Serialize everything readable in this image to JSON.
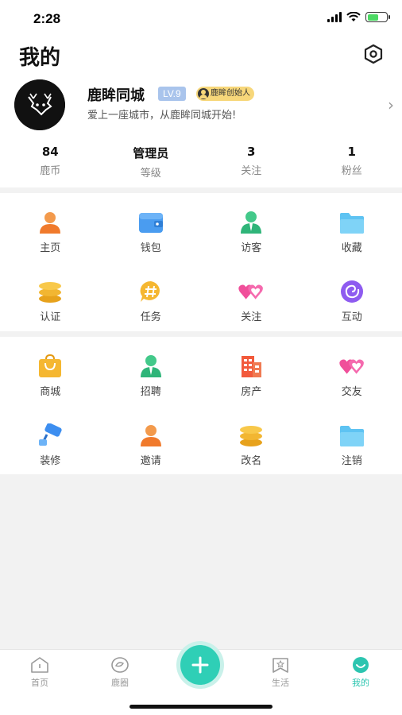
{
  "status": {
    "time": "2:28"
  },
  "header": {
    "title": "我的"
  },
  "profile": {
    "name": "鹿眸同城",
    "level": "LV.9",
    "badge": "鹿眸创始人",
    "bio": "爱上一座城市，从鹿眸同城开始!"
  },
  "stats": [
    {
      "value": "84",
      "label": "鹿币"
    },
    {
      "value": "管理员",
      "label": "等级"
    },
    {
      "value": "3",
      "label": "关注"
    },
    {
      "value": "1",
      "label": "粉丝"
    }
  ],
  "grid1": [
    {
      "label": "主页",
      "icon": "person-icon"
    },
    {
      "label": "钱包",
      "icon": "wallet-icon"
    },
    {
      "label": "访客",
      "icon": "visitor-icon"
    },
    {
      "label": "收藏",
      "icon": "folder-icon"
    },
    {
      "label": "认证",
      "icon": "coins-icon"
    },
    {
      "label": "任务",
      "icon": "hashtag-icon"
    },
    {
      "label": "关注",
      "icon": "hearts-icon"
    },
    {
      "label": "互动",
      "icon": "swirl-icon"
    }
  ],
  "grid2": [
    {
      "label": "商城",
      "icon": "shopping-bag-icon"
    },
    {
      "label": "招聘",
      "icon": "recruit-icon"
    },
    {
      "label": "房产",
      "icon": "building-icon"
    },
    {
      "label": "交友",
      "icon": "hearts-icon"
    },
    {
      "label": "装修",
      "icon": "paint-roller-icon"
    },
    {
      "label": "邀请",
      "icon": "person-icon"
    },
    {
      "label": "改名",
      "icon": "coins-icon"
    },
    {
      "label": "注销",
      "icon": "folder-icon"
    }
  ],
  "tabs": [
    {
      "label": "首页",
      "icon": "home-icon"
    },
    {
      "label": "鹿圈",
      "icon": "circle-icon"
    },
    {
      "label": "生活",
      "icon": "life-icon"
    },
    {
      "label": "我的",
      "icon": "me-icon"
    }
  ],
  "colors": {
    "accent": "#2cc5b0",
    "level": "#a9c4ec",
    "badge": "#f7d77a"
  }
}
